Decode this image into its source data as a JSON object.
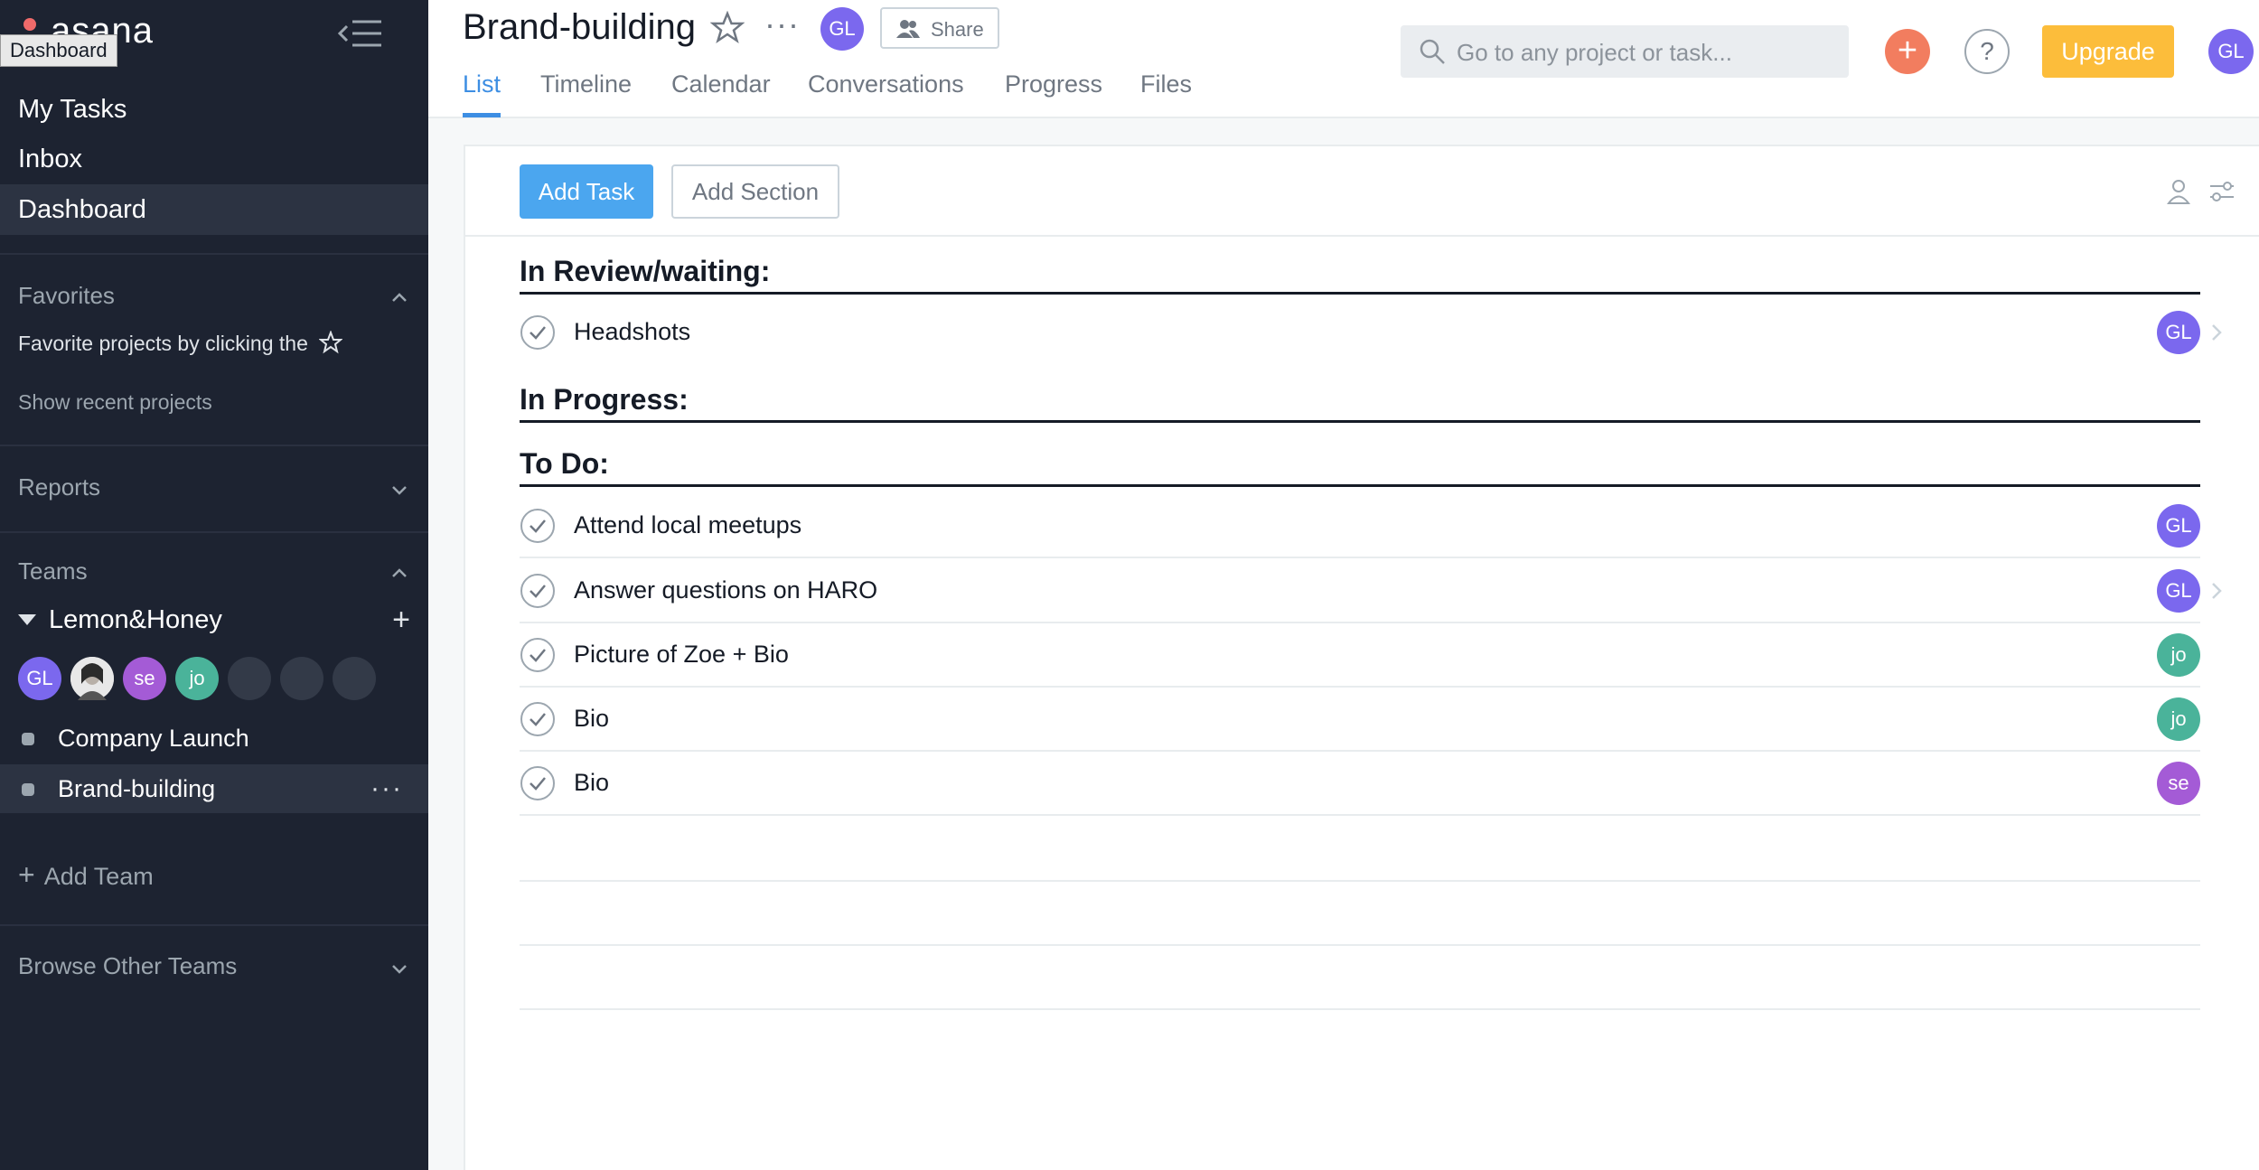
{
  "sidebar": {
    "logo": "asana",
    "tooltip": "Dashboard",
    "nav": [
      {
        "label": "My Tasks"
      },
      {
        "label": "Inbox"
      },
      {
        "label": "Dashboard"
      }
    ],
    "favorites": {
      "heading": "Favorites",
      "hint": "Favorite projects by clicking the",
      "show_recent": "Show recent projects"
    },
    "reports_heading": "Reports",
    "teams_heading": "Teams",
    "team": {
      "name": "Lemon&Honey",
      "members": [
        {
          "initials": "GL",
          "color": "#7b68ee"
        },
        {
          "initials": "",
          "color": "#c8c8c8"
        },
        {
          "initials": "se",
          "color": "#a45bd6"
        },
        {
          "initials": "jo",
          "color": "#4ab39a"
        },
        {
          "initials": "",
          "color": "#333a48"
        },
        {
          "initials": "",
          "color": "#333a48"
        },
        {
          "initials": "",
          "color": "#333a48"
        }
      ],
      "projects": [
        {
          "label": "Company Launch"
        },
        {
          "label": "Brand-building"
        }
      ]
    },
    "add_team": "Add Team",
    "browse_teams": "Browse Other Teams"
  },
  "header": {
    "project_title": "Brand-building",
    "owner_initials": "GL",
    "share_label": "Share",
    "tabs": [
      {
        "label": "List"
      },
      {
        "label": "Timeline"
      },
      {
        "label": "Calendar"
      },
      {
        "label": "Conversations"
      },
      {
        "label": "Progress"
      },
      {
        "label": "Files"
      }
    ],
    "search_placeholder": "Go to any project or task...",
    "quick_add": "+",
    "help": "?",
    "upgrade_label": "Upgrade",
    "user_initials": "GL"
  },
  "toolbar": {
    "add_task": "Add Task",
    "add_section": "Add Section"
  },
  "sections": [
    {
      "title": "In Review/waiting:",
      "tasks": [
        {
          "name": "Headshots",
          "assignee": "GL",
          "color": "#7b68ee"
        }
      ]
    },
    {
      "title": "In Progress:",
      "tasks": []
    },
    {
      "title": "To Do:",
      "tasks": [
        {
          "name": "Attend local meetups",
          "assignee": "GL",
          "color": "#7b68ee"
        },
        {
          "name": "Answer questions on HARO",
          "assignee": "GL",
          "color": "#7b68ee"
        },
        {
          "name": "Picture of Zoe + Bio",
          "assignee": "jo",
          "color": "#4ab39a"
        },
        {
          "name": "Bio",
          "assignee": "jo",
          "color": "#4ab39a"
        },
        {
          "name": "Bio",
          "assignee": "se",
          "color": "#a45bd6"
        }
      ]
    }
  ],
  "colors": {
    "sidebar_bg": "#1d2331",
    "accent_blue": "#3d8ee3",
    "upgrade": "#fcbd3b",
    "quick_add": "#f27d5f"
  }
}
